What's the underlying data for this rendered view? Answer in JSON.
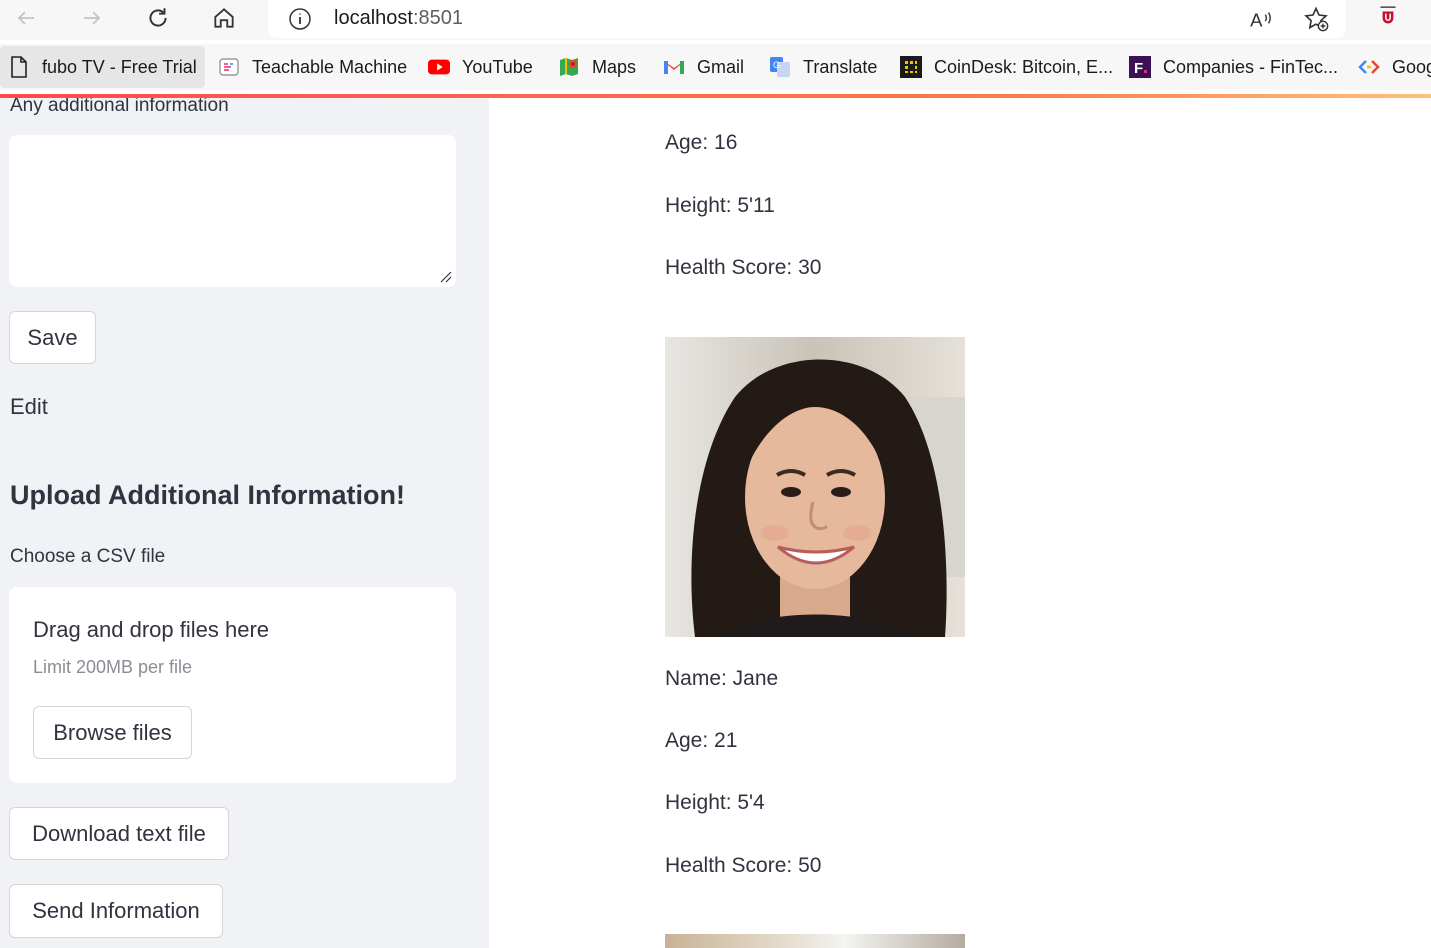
{
  "browser": {
    "url_host": "localhost",
    "url_port": ":8501",
    "bookmarks": [
      {
        "label": "fubo TV - Free Trial",
        "icon": "page-icon"
      },
      {
        "label": "Teachable Machine",
        "icon": "teachable-icon"
      },
      {
        "label": "YouTube",
        "icon": "youtube-icon"
      },
      {
        "label": "Maps",
        "icon": "maps-icon"
      },
      {
        "label": "Gmail",
        "icon": "gmail-icon"
      },
      {
        "label": "Translate",
        "icon": "translate-icon"
      },
      {
        "label": "CoinDesk: Bitcoin, E...",
        "icon": "coindesk-icon"
      },
      {
        "label": "Companies - FinTec...",
        "icon": "fintech-icon"
      },
      {
        "label": "Goog",
        "icon": "google-icon"
      }
    ]
  },
  "sidebar": {
    "additional_info_label": "Any additional information",
    "save_label": "Save",
    "edit_label": "Edit",
    "upload_heading": "Upload Additional Information!",
    "csv_label": "Choose a CSV file",
    "dropzone_title": "Drag and drop files here",
    "dropzone_limit": "Limit 200MB per file",
    "browse_label": "Browse files",
    "download_label": "Download text file",
    "send_label": "Send Information"
  },
  "main": {
    "person1": {
      "age": "Age: 16",
      "height": "Height: 5'11",
      "health": "Health Score: 30"
    },
    "person2": {
      "name": "Name: Jane",
      "age": "Age: 21",
      "height": "Height: 5'4",
      "health": "Health Score: 50"
    }
  },
  "colors": {
    "accent": "#ff4b4b",
    "sidebar_bg": "#f0f2f6",
    "text": "#31333f"
  }
}
